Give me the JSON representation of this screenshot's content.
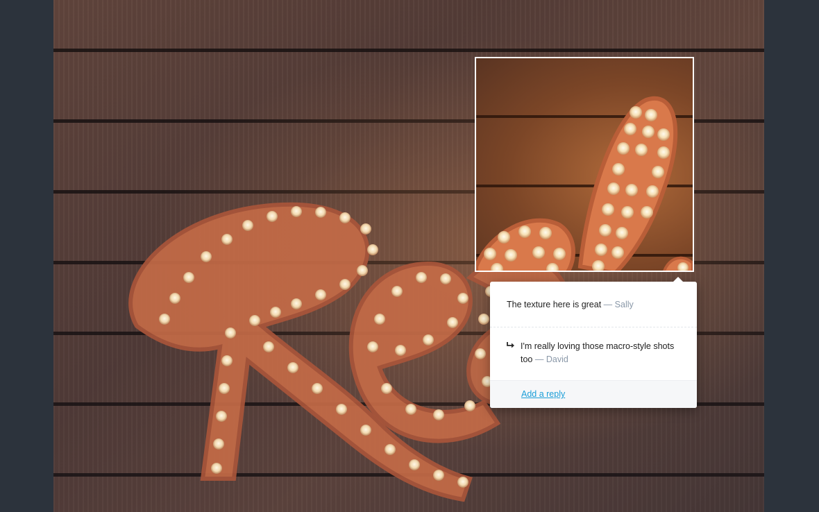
{
  "comments": {
    "main": {
      "text": "The texture here is great",
      "separator": "—",
      "author": "Sally"
    },
    "reply": {
      "text": "I'm really loving those macro-style shots too",
      "separator": "—",
      "author": "David",
      "icon": "reply-arrow-icon"
    },
    "footer": {
      "add_reply_label": "Add a reply"
    }
  },
  "colors": {
    "background": "#2c333c",
    "link": "#1a9ed8",
    "author": "#8a98a8",
    "crop_border": "#ffffff"
  }
}
